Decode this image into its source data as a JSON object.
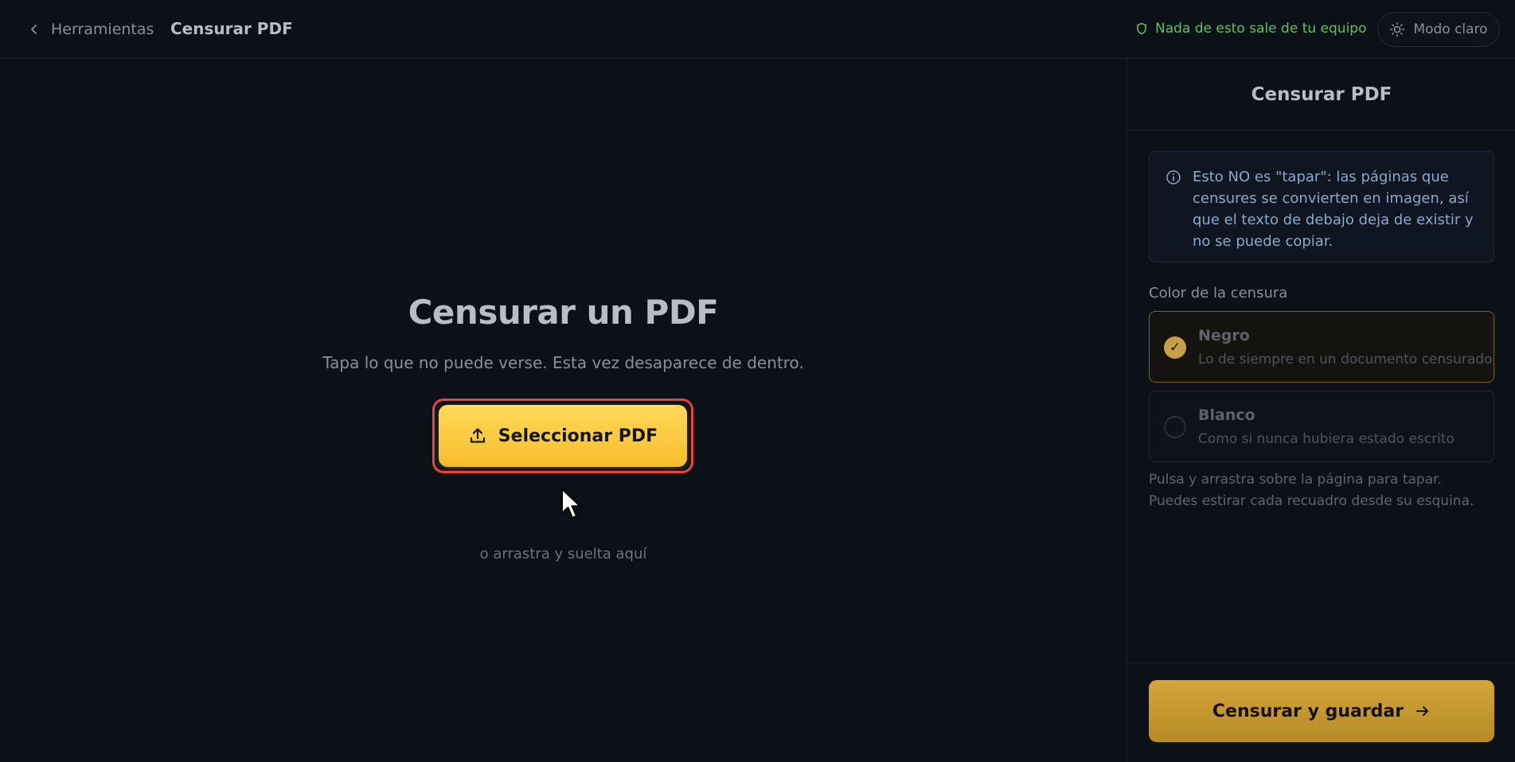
{
  "topbar": {
    "back_label": "Herramientas",
    "title": "Censurar PDF",
    "privacy_text": "Nada de esto sale de tu equipo",
    "mode_label": "Modo claro"
  },
  "main": {
    "title": "Censurar un PDF",
    "subtitle": "Tapa lo que no puede verse. Esta vez desaparece de dentro.",
    "upload_label": "Seleccionar PDF",
    "drop_hint": "o arrastra y suelta aquí"
  },
  "panel": {
    "title": "Censurar PDF",
    "info": "Esto NO es \"tapar\": las páginas que censures se convierten en imagen, así que el texto de debajo deja de existir y no se puede copiar.",
    "color_label": "Color de la censura",
    "options": [
      {
        "title": "Negro",
        "desc": "Lo de siempre en un documento censurado",
        "selected": true
      },
      {
        "title": "Blanco",
        "desc": "Como si nunca hubiera estado escrito",
        "selected": false
      }
    ],
    "hint": "Pulsa y arrastra sobre la página para tapar. Puedes estirar cada recuadro desde su esquina.",
    "save_label": "Censurar y guardar"
  },
  "colors": {
    "accent": "#f6bd2a",
    "highlight_ring": "#e5433f",
    "privacy_green": "#5fc06a",
    "info_text": "#8aa9cc"
  }
}
